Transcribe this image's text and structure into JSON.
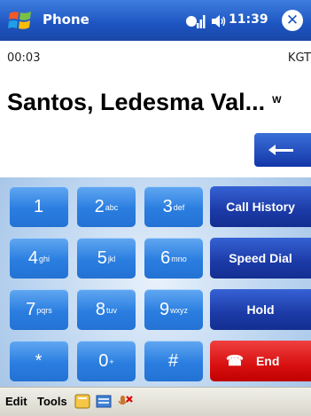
{
  "titlebar": {
    "title": "Phone",
    "time": "11:39",
    "close_label": "✕",
    "icons": [
      "windows-start-icon",
      "signal-icon",
      "volume-icon"
    ]
  },
  "call": {
    "timer": "00:03",
    "carrier": "KGT",
    "contact_name": "Santos, Ledesma Val...",
    "contact_flag": "W",
    "backspace_icon": "backspace-arrow-icon"
  },
  "keypad": {
    "keys": [
      {
        "digit": "1",
        "letters": ""
      },
      {
        "digit": "2",
        "letters": "abc"
      },
      {
        "digit": "3",
        "letters": "def"
      },
      {
        "digit": "4",
        "letters": "ghi"
      },
      {
        "digit": "5",
        "letters": "jkl"
      },
      {
        "digit": "6",
        "letters": "mno"
      },
      {
        "digit": "7",
        "letters": "pqrs"
      },
      {
        "digit": "8",
        "letters": "tuv"
      },
      {
        "digit": "9",
        "letters": "wxyz"
      },
      {
        "digit": "*",
        "letters": ""
      },
      {
        "digit": "0",
        "letters": "+"
      },
      {
        "digit": "#",
        "letters": ""
      }
    ],
    "actions": {
      "call_history": "Call History",
      "speed_dial": "Speed Dial",
      "hold": "Hold",
      "end": "End",
      "end_icon": "phone-handset-icon"
    }
  },
  "menubar": {
    "edit": "Edit",
    "tools": "Tools",
    "icons": [
      "contacts-card-icon",
      "keyboard-icon",
      "mute-microphone-icon"
    ]
  },
  "colors": {
    "title_bar": "#1d54c0",
    "key_blue": "#2a7ee0",
    "action_navy": "#1b3aa6",
    "end_red": "#d81010"
  }
}
